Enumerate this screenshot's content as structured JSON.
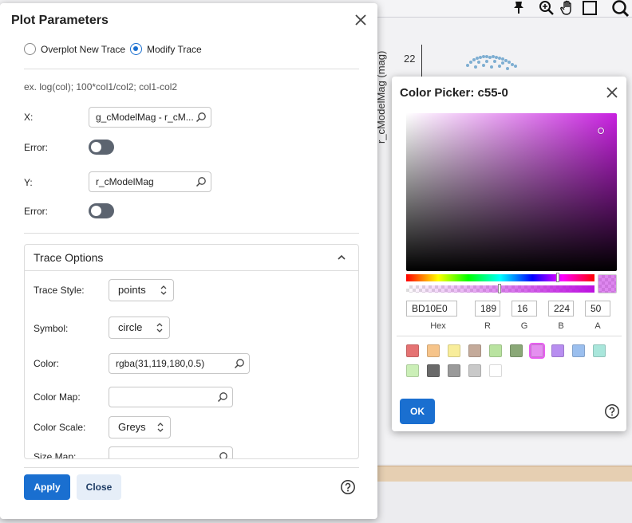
{
  "plot_dialog": {
    "title": "Plot Parameters",
    "radio_overplot": "Overplot New Trace",
    "radio_modify": "Modify Trace",
    "expression_hint": "ex. log(col); 100*col1/col2; col1-col2",
    "x_label": "X:",
    "x_value": "g_cModelMag - r_cM...",
    "x_error_label": "Error:",
    "y_label": "Y:",
    "y_value": "r_cModelMag",
    "y_error_label": "Error:",
    "trace_options": {
      "title": "Trace Options",
      "trace_style_label": "Trace Style:",
      "trace_style_value": "points",
      "symbol_label": "Symbol:",
      "symbol_value": "circle",
      "color_label": "Color:",
      "color_value": "rgba(31,119,180,0.5)",
      "color_map_label": "Color Map:",
      "color_map_value": "",
      "color_scale_label": "Color Scale:",
      "color_scale_value": "Greys",
      "size_map_label": "Size Map:"
    },
    "apply_label": "Apply",
    "close_label": "Close"
  },
  "color_picker": {
    "title": "Color Picker: c55-0",
    "hex": "BD10E0",
    "r": "189",
    "g": "16",
    "b": "224",
    "a": "50",
    "hex_label": "Hex",
    "r_label": "R",
    "g_label": "G",
    "b_label": "B",
    "a_label": "A",
    "current_color": "#BD10E0",
    "alpha_percent": 50,
    "presets": [
      "#e57373",
      "#f6c48a",
      "#f8ed9a",
      "#c4aa9a",
      "#b9e3a0",
      "#8aa877",
      "#e58ff0",
      "#b88ef0",
      "#9bbfee",
      "#a9e6db",
      "#cbefb7",
      "#6a6a6a",
      "#9a9a9a",
      "#c9c9c9",
      "#ffffff"
    ],
    "ok_label": "OK"
  },
  "background": {
    "axis_tick_label": "22",
    "y_axis_label": "r_cModelMag (mag)"
  }
}
